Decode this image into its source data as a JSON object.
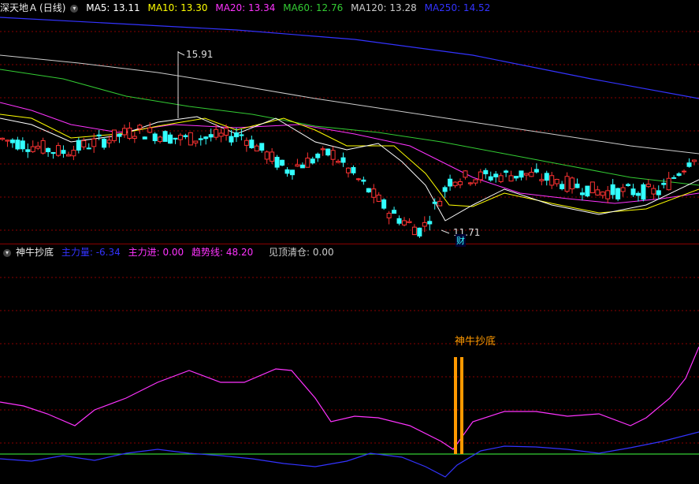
{
  "main_panel": {
    "stock_name": "深天地Ａ",
    "period": "(日线)",
    "ma": [
      {
        "label": "MA5: 13.11",
        "color": "#ffffff"
      },
      {
        "label": "MA10: 13.30",
        "color": "#ffff00"
      },
      {
        "label": "MA20: 13.34",
        "color": "#ff33ff"
      },
      {
        "label": "MA60: 12.76",
        "color": "#33cc33"
      },
      {
        "label": "MA120: 13.28",
        "color": "#cccccc"
      },
      {
        "label": "MA250: 14.52",
        "color": "#3333ff"
      }
    ],
    "high_label": "15.91",
    "low_label": "11.71",
    "marker": "财"
  },
  "sub_panel": {
    "indicator_name": "神牛抄底",
    "items": [
      {
        "label": "主力量: -6.34",
        "color": "#3333ff"
      },
      {
        "label": "主力进: 0.00",
        "color": "#ff33ff"
      },
      {
        "label": "趋势线: 48.20",
        "color": "#ff33ff"
      },
      {
        "label": "见顶清仓: 0.00",
        "color": "#cccccc"
      }
    ],
    "signal_label": "神牛抄底"
  },
  "colors": {
    "up": "#ff3333",
    "down": "#33ffff",
    "signal": "#ff9900",
    "grid": "#8a0000",
    "zero": "#33cc33"
  },
  "chart_data": {
    "type": "line",
    "price_panel": {
      "high": 15.91,
      "low": 11.71,
      "ma_last": {
        "MA5": 13.11,
        "MA10": 13.3,
        "MA20": 13.34,
        "MA60": 12.76,
        "MA120": 13.28,
        "MA250": 14.52
      }
    }
  }
}
